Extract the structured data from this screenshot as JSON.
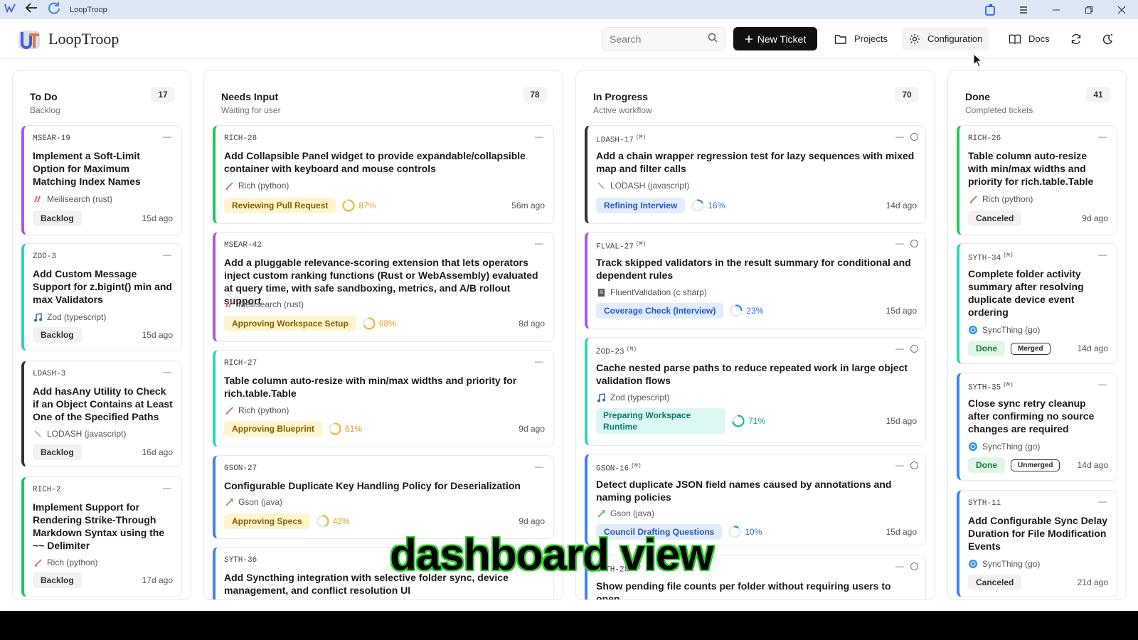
{
  "window": {
    "title": "LoopTroop"
  },
  "app": {
    "name": "LoopTroop"
  },
  "search": {
    "placeholder": "Search"
  },
  "nav": {
    "new_ticket": "New Ticket",
    "projects": "Projects",
    "configuration": "Configuration",
    "docs": "Docs"
  },
  "columns": [
    {
      "title": "To Do",
      "subtitle": "Backlog",
      "count": "17",
      "accent": "#a855f7"
    },
    {
      "title": "Needs Input",
      "subtitle": "Waiting for user",
      "count": "78",
      "accent": "#f59e0b"
    },
    {
      "title": "In Progress",
      "subtitle": "Active workflow",
      "count": "70",
      "accent": "#3b82f6"
    },
    {
      "title": "Done",
      "subtitle": "Completed tickets",
      "count": "41",
      "accent": "#22c55e"
    }
  ],
  "cards": {
    "todo": [
      {
        "id": "MSEAR-19",
        "title": "Implement a Soft-Limit Option for Maximum Matching Index Names",
        "repo": "Meilisearch (rust)",
        "status": "Backlog",
        "age": "15d ago"
      },
      {
        "id": "ZOD-3",
        "title": "Add Custom Message Support for z.bigint() min and max Validators",
        "repo": "Zod (typescript)",
        "status": "Backlog",
        "age": "15d ago"
      },
      {
        "id": "LDASH-3",
        "title": "Add hasAny Utility to Check if an Object Contains at Least One of the Specified Paths",
        "repo": "LODASH (javascript)",
        "status": "Backlog",
        "age": "16d ago"
      },
      {
        "id": "RICH-2",
        "title": "Implement Support for Rendering Strike-Through Markdown Syntax using the ~~ Delimiter",
        "repo": "Rich (python)",
        "status": "Backlog",
        "age": "17d ago"
      }
    ],
    "needs_input": [
      {
        "id": "RICH-28",
        "title": "Add Collapsible Panel widget to provide expandable/collapsible container with keyboard and mouse controls",
        "repo": "Rich (python)",
        "status": "Reviewing Pull Request",
        "progress": 87,
        "progress_label": "87%",
        "age": "56m ago"
      },
      {
        "id": "MSEAR-42",
        "title": "Add a pluggable relevance-scoring extension that lets operators inject custom ranking functions (Rust or WebAssembly) evaluated at query time, with safe sandboxing, metrics, and A/B rollout support",
        "repo": "Meilisearch (rust)",
        "status": "Approving Workspace Setup",
        "progress": 68,
        "progress_label": "68%",
        "age": "8d ago"
      },
      {
        "id": "RICH-27",
        "title": "Table column auto-resize with min/max widths and priority for rich.table.Table",
        "repo": "Rich (python)",
        "status": "Approving Blueprint",
        "progress": 61,
        "progress_label": "61%",
        "age": "9d ago"
      },
      {
        "id": "GSON-27",
        "title": "Configurable Duplicate Key Handling Policy for Deserialization",
        "repo": "Gson (java)",
        "status": "Approving Specs",
        "progress": 42,
        "progress_label": "42%",
        "age": "9d ago"
      },
      {
        "id": "SYTH-36",
        "title": "Add Syncthing integration with selective folder sync, device management, and conflict resolution UI"
      }
    ],
    "in_progress": [
      {
        "id": "LDASH-17",
        "mark": "(M)",
        "title": "Add a chain wrapper regression test for lazy sequences with mixed map and filter calls",
        "repo": "LODASH (javascript)",
        "status": "Refining Interview",
        "progress": 16,
        "progress_label": "16%",
        "age": "14d ago"
      },
      {
        "id": "FLVAL-27",
        "mark": "(M)",
        "title": "Track skipped validators in the result summary for conditional and dependent rules",
        "repo": "FluentValidation (c sharp)",
        "status": "Coverage Check (Interview)",
        "progress": 23,
        "progress_label": "23%",
        "age": "15d ago"
      },
      {
        "id": "ZOD-23",
        "mark": "(M)",
        "title": "Cache nested parse paths to reduce repeated work in large object validation flows",
        "repo": "Zod (typescript)",
        "status": "Preparing Workspace Runtime",
        "progress": 71,
        "progress_label": "71%",
        "age": "15d ago"
      },
      {
        "id": "GSON-16",
        "mark": "(M)",
        "title": "Detect duplicate JSON field names caused by annotations and naming policies",
        "repo": "Gson (java)",
        "status": "Council Drafting Questions",
        "progress": 10,
        "progress_label": "10%",
        "age": "15d ago"
      },
      {
        "id": "SYTH-28",
        "mark": "(M)",
        "title": "Show pending file counts per folder without requiring users to open"
      }
    ],
    "done": [
      {
        "id": "RICH-26",
        "title": "Table column auto-resize with min/max widths and priority for rich.table.Table",
        "repo": "Rich (python)",
        "status": "Canceled",
        "age": "9d ago"
      },
      {
        "id": "SYTH-34",
        "mark": "(M)",
        "title": "Complete folder activity summary after resolving duplicate device event ordering",
        "repo": "SyncThing (go)",
        "status": "Done",
        "merge": "Merged",
        "age": "14d ago"
      },
      {
        "id": "SYTH-35",
        "mark": "(M)",
        "title": "Close sync retry cleanup after confirming no source changes are required",
        "repo": "SyncThing (go)",
        "status": "Done",
        "merge": "Unmerged",
        "age": "14d ago"
      },
      {
        "id": "SYTH-11",
        "title": "Add Configurable Sync Delay Duration for File Modification Events",
        "repo": "SyncThing (go)",
        "status": "Canceled",
        "age": "21d ago"
      }
    ]
  },
  "caption": "dashboard view",
  "icons": {
    "back": "arrow-left-icon",
    "refresh": "refresh-icon",
    "search": "search-icon",
    "gear": "gear-icon",
    "folder": "folder-icon",
    "book": "book-icon",
    "theme": "theme-icon"
  }
}
